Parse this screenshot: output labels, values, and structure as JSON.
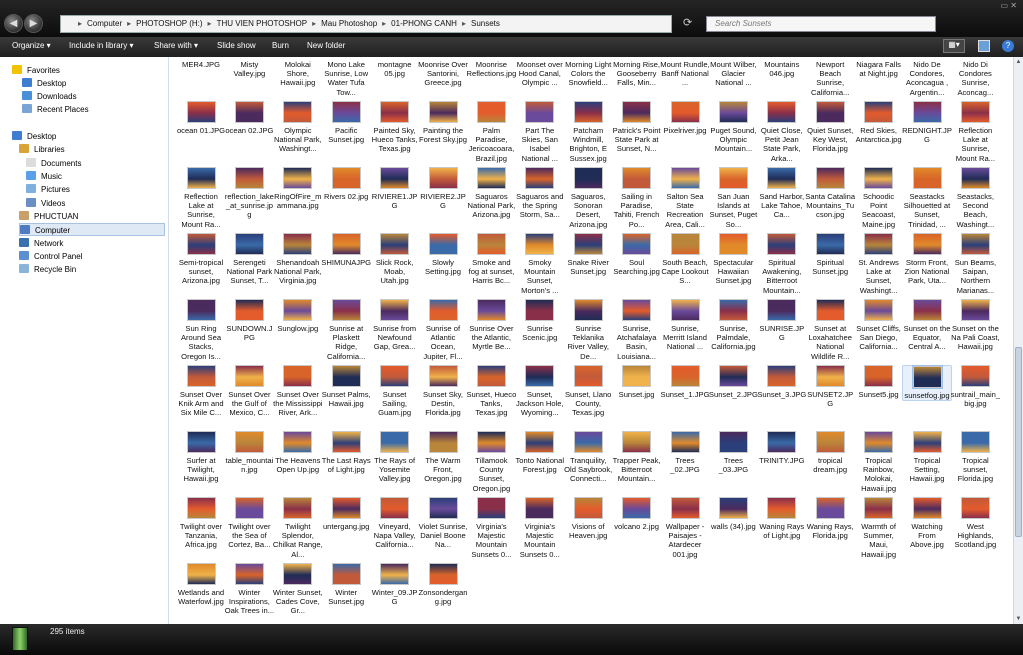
{
  "address": {
    "crumbs": [
      "Computer",
      "PHOTOSHOP (H:)",
      "THU VIEN PHOTOSHOP",
      "Mau Photoshop",
      "01-PHONG CANH",
      "Sunsets"
    ],
    "search_placeholder": "Search Sunsets"
  },
  "toolbar": {
    "organize": "Organize ▾",
    "include": "Include in library ▾",
    "share": "Share with ▾",
    "slideshow": "Slide show",
    "burn": "Burn",
    "newfolder": "New folder"
  },
  "nav": [
    {
      "label": "Favorites",
      "icon": "star-icon",
      "color": "#f2c400"
    },
    {
      "label": "Desktop",
      "icon": "desktop-icon",
      "color": "#3f7dd1"
    },
    {
      "label": "Downloads",
      "icon": "downloads-icon",
      "color": "#4a90d9"
    },
    {
      "label": "Recent Places",
      "icon": "recent-places-icon",
      "color": "#7aa3d6"
    },
    {
      "label": "Desktop",
      "icon": "desktop-icon",
      "color": "#3f7dd1"
    },
    {
      "label": "Libraries",
      "icon": "libraries-icon",
      "color": "#d9a436"
    },
    {
      "label": "Documents",
      "icon": "documents-icon",
      "color": "#dcdcdc"
    },
    {
      "label": "Music",
      "icon": "music-icon",
      "color": "#5aa0e8"
    },
    {
      "label": "Pictures",
      "icon": "pictures-icon",
      "color": "#7fb0e0"
    },
    {
      "label": "Videos",
      "icon": "videos-icon",
      "color": "#6b8fc3"
    },
    {
      "label": "PHUCTUAN",
      "icon": "user-icon",
      "color": "#c8a16a"
    },
    {
      "label": "Computer",
      "icon": "computer-icon",
      "color": "#4f7cc0"
    },
    {
      "label": "Network",
      "icon": "network-icon",
      "color": "#3a6fb0"
    },
    {
      "label": "Control Panel",
      "icon": "control-panel-icon",
      "color": "#5a8fd0"
    },
    {
      "label": "Recycle Bin",
      "icon": "recycle-bin-icon",
      "color": "#8ab4d8"
    }
  ],
  "rows": [
    [
      "MER4.JPG",
      "Misty Valley.jpg",
      "Molokai Shore, Hawaii.jpg",
      "Mono Lake Sunrise, Low Water Tufa Tow...",
      "montagne 05.jpg",
      "Moonrise Over Santorini, Greece.jpg",
      "Moonrise Reflections.jpg",
      "Moonset over Hood Canal, Olympic ...",
      "Morning Light Colors the Snowfield...",
      "Morning Rise, Gooseberry Falls, Min...",
      "Mount Rundle, Banff National ...",
      "Mount Wilber, Glacier National ...",
      "Mountains 046.jpg",
      "Newport Beach Sunrise, California...",
      "Niagara Falls at Night.jpg",
      "Nido De Condores, Aconcagua , Argentin...",
      "Nido Di Condores Sunrise, Aconcag..."
    ],
    [
      "ocean 01.JPG",
      "ocean 02.JPG",
      "Olympic National Park, Washingt...",
      "Pacific Sunset.jpg",
      "Painted Sky, Hueco Tanks, Texas.jpg",
      "Painting the Forest Sky.jpg",
      "Palm Paradise, Jericoacoara, Brazil.jpg",
      "Part The Skies, San Isabel National ...",
      "Patcham Windmill, Brighton, E Sussex.jpg",
      "Patrick's Point State Park at Sunset, N...",
      "Pixelriver.jpg",
      "Puget Sound, Olympic Mountain...",
      "Quiet Close, Petit Jean State Park, Arka...",
      "Quiet Sunset, Key West, Florida.jpg",
      "Red Skies, Antarctica.jpg",
      "REDNIGHT.JPG",
      "Reflection Lake at Sunrise, Mount Ra..."
    ],
    [
      "Reflection Lake at Sunrise, Mount Ra...",
      "reflection_lake_at_sunrise.jpg",
      "RingOfFire_mammana.jpg",
      "Rivers 02.jpg",
      "RIVIERE1.JPG",
      "RIVIERE2.JPG",
      "Saguaros National Park, Arizona.jpg",
      "Saguaros and the Spring Storm, Sa...",
      "Saguaros, Sonoran Desert, Arizona.jpg",
      "Sailing in Paradise, Tahiti, French Po...",
      "Salton Sea State Recreation Area, Cali...",
      "San Juan Islands at Sunset, Puget So...",
      "Sand Harbor, Lake Tahoe, Ca...",
      "Santa Catalina Mountains_Tucson.jpg",
      "Schoodic Point Seacoast, Maine.jpg",
      "Seastacks Silhouetted at Sunset, Trinidad, ...",
      "Seastacks, Second Beach, Washingt..."
    ],
    [
      "Semi-tropical sunset, Arizona.jpg",
      "Serengeti National Park Sunset, T...",
      "Shenandoah National Park, Virginia.jpg",
      "SHIMUNAJPG",
      "Slick Rock, Moab, Utah.jpg",
      "Slowly Setting.jpg",
      "Smoke and fog at sunset, Harris Bc...",
      "Smoky Mountain Sunset, Morton's ...",
      "Snake River Sunset.jpg",
      "Soul Searching.jpg",
      "South Beach, Cape Lookout S...",
      "Spectacular Hawaiian Sunset.jpg",
      "Spiritual Awakening, Bitterroot Mountain...",
      "Spiritual Sunset.jpg",
      "St. Andrews Lake at Sunset, Washingt...",
      "Storm Front, Zion National Park, Uta...",
      "Sun Beams, Saipan, Northern Marianas..."
    ],
    [
      "Sun Ring Around Sea Stacks, Oregon Is...",
      "SUNDOWN.JPG",
      "Sunglow.jpg",
      "Sunrise at Plaskett Ridge, California...",
      "Sunrise from Newfound Gap, Grea...",
      "Sunrise of Atlantic Ocean, Jupiter, Fl...",
      "Sunrise Over the Atlantic, Myrtle Be...",
      "Sunrise Scenic.jpg",
      "Sunrise Teklanika River Valley, De...",
      "Sunrise, Atchafalaya Basin, Louisiana...",
      "Sunrise, Merritt Island National ...",
      "Sunrise, Palmdale, California.jpg",
      "SUNRISE.JPG",
      "Sunset at Loxahatchee National Wildlife R...",
      "Sunset Cliffs, San Diego, California...",
      "Sunset on the Equator, Central A...",
      "Sunset on the Na Pali Coast, Hawaii.jpg"
    ],
    [
      "Sunset Over Knik Arm and Six Mile C...",
      "Sunset Over the Gulf of Mexico, C...",
      "Sunset Over the Mississippi River, Ark...",
      "Sunset Palms, Hawaii.jpg",
      "Sunset Sailing, Guam.jpg",
      "Sunset Sky, Destin, Florida.jpg",
      "Sunset, Hueco Tanks, Texas.jpg",
      "Sunset, Jackson Hole, Wyoming...",
      "Sunset, Llano County, Texas.jpg",
      "Sunset.jpg",
      "Sunset_1.JPG",
      "Sunset_2.JPG",
      "Sunset_3.JPG",
      "SUNSET2.JPG",
      "Sunset5.jpg",
      "sunsetfog.jpg",
      "suntrail_main_big.jpg"
    ],
    [
      "Surfer at Twilight, Hawaii.jpg",
      "table_mountain.jpg",
      "The Heavens Open Up.jpg",
      "The Last Rays of Light.jpg",
      "The Rays of Yosemite Valley.jpg",
      "The Warm Front, Oregon.jpg",
      "Tillamook County Sunset, Oregon.jpg",
      "Tonto National Forest.jpg",
      "Tranquility, Old Saybrook, Connecti...",
      "Trapper Peak, Bitterroot Mountain...",
      "Trees _02.JPG",
      "Trees _03.JPG",
      "TRINITY.JPG",
      "tropical dream.jpg",
      "Tropical Rainbow, Molokai, Hawaii.jpg",
      "Tropical Setting, Hawaii.jpg",
      "Tropical sunset, Florida.jpg"
    ],
    [
      "Twilight over Tanzania, Africa.jpg",
      "Twilight over the Sea of Cortez, Ba...",
      "Twilight Splendor, Chilkat Range, Al...",
      "untergang.jpg",
      "Vineyard, Napa Valley, California...",
      "Violet Sunrise, Daniel Boone Na...",
      "Virginia's Majestic Mountain Sunsets 0...",
      "Virginia's Majestic Mountain Sunsets 0...",
      "Visions of Heaven.jpg",
      "volcano 2.jpg",
      "Wallpaper - Paisajes - Atardecer 001.jpg",
      "walls (34).jpg",
      "Waning Rays of Light.jpg",
      "Waning Rays, Florida.jpg",
      "Warmth of Summer, Maui, Hawaii.jpg",
      "Watching From Above.jpg",
      "West Highlands, Scotland.jpg"
    ],
    [
      "Wetlands and Waterfowl.jpg",
      "Winter Inspirations, Oak Trees in...",
      "Winter Sunset, Cades Cove, Gr...",
      "Winter Sunset.jpg",
      "Winter_09.JPG",
      "Zonsondergang.jpg"
    ]
  ],
  "status": {
    "count": "295 items"
  },
  "colors": {
    "titlebar": "#1a1a1a",
    "selection": "#dfe9f6",
    "sunset_palette": [
      "#e08a2a",
      "#c25a3a",
      "#6a4a9a",
      "#2b3f7a",
      "#f0b24a",
      "#8a2f4a",
      "#3a6aa8",
      "#d8642a",
      "#4b2a5e",
      "#b8853a",
      "#1f2c55",
      "#e45b2c"
    ]
  }
}
